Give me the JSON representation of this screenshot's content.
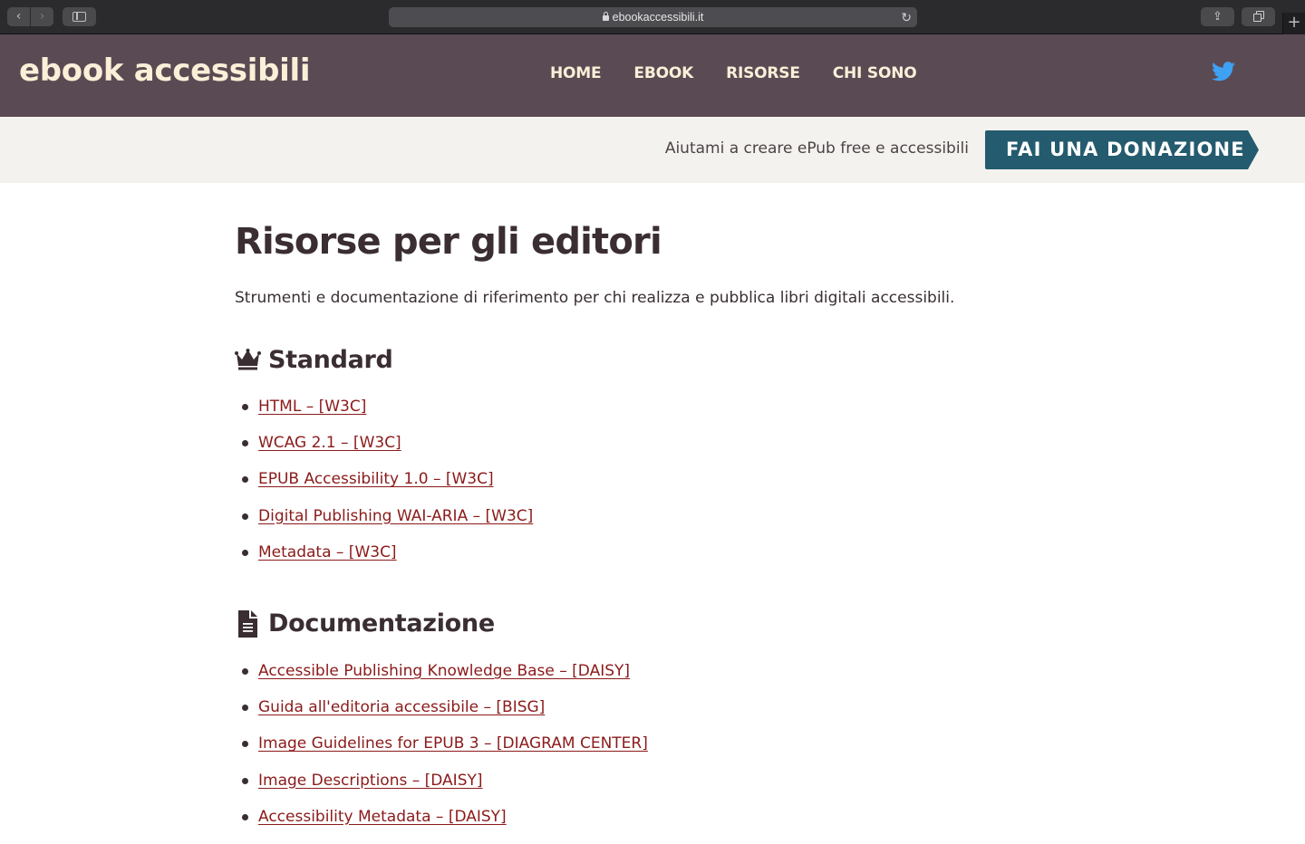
{
  "browser": {
    "back_glyph": "‹",
    "forward_glyph": "›",
    "url": "ebookaccessibili.it",
    "reload_glyph": "↻",
    "share_glyph": "⇪",
    "newtab_glyph": "+"
  },
  "site": {
    "logo": "ebook accessibili",
    "nav": [
      "HOME",
      "EBOOK",
      "RISORSE",
      "CHI SONO"
    ],
    "social_icon": "twitter-icon",
    "colors": {
      "header_bg": "#5a4a53",
      "logo": "#fbefd8",
      "accent": "#245b6e",
      "link": "#8b1a1a",
      "twitter": "#3ea1f2"
    }
  },
  "donate": {
    "text": "Aiutami a creare ePub free e accessibili",
    "button": "FAI UNA DONAZIONE"
  },
  "page": {
    "title": "Risorse per gli editori",
    "intro": "Strumenti e documentazione di riferimento per chi realizza e pubblica libri digitali accessibili.",
    "sections": [
      {
        "icon": "crown-icon",
        "heading": "Standard",
        "links": [
          "HTML – [W3C]",
          "WCAG 2.1 – [W3C]",
          "EPUB Accessibility 1.0 – [W3C]",
          "Digital Publishing WAI-ARIA – [W3C]",
          "Metadata – [W3C]"
        ]
      },
      {
        "icon": "document-icon",
        "heading": "Documentazione",
        "links": [
          "Accessible Publishing Knowledge Base – [DAISY]",
          "Guida all'editoria accessibile – [BISG]",
          "Image Guidelines for EPUB 3 – [DIAGRAM CENTER]",
          "Image Descriptions – [DAISY]",
          "Accessibility Metadata – [DAISY]"
        ]
      }
    ]
  }
}
